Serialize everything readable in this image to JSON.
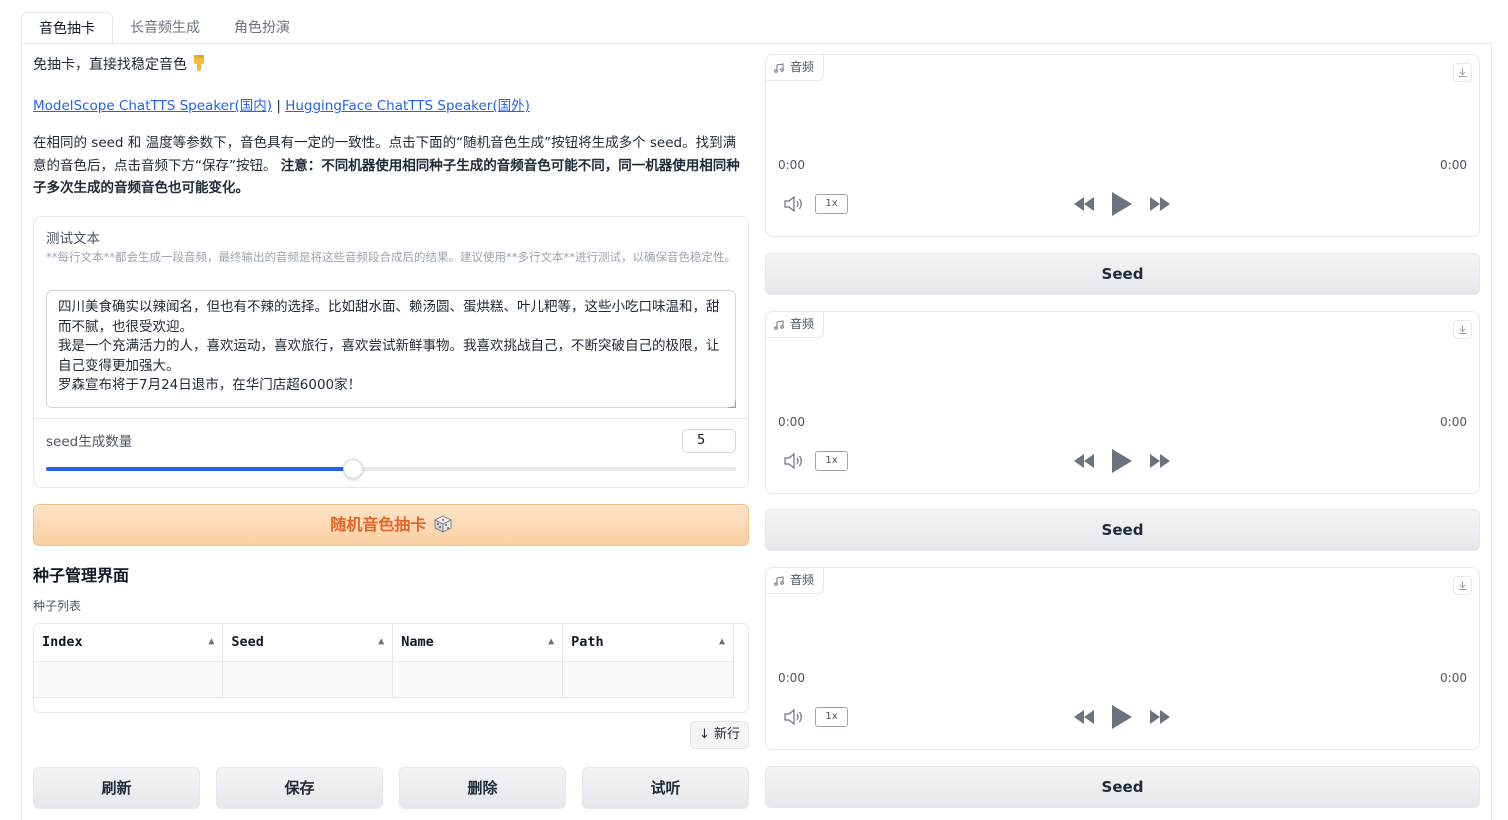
{
  "tabs": [
    {
      "label": "音色抽卡",
      "active": true
    },
    {
      "label": "长音频生成",
      "active": false
    },
    {
      "label": "角色扮演",
      "active": false
    }
  ],
  "intro": {
    "headline": "免抽卡，直接找稳定音色",
    "link1": "ModelScope ChatTTS Speaker(国内)",
    "link_sep": " | ",
    "link2": "HuggingFace ChatTTS Speaker(国外)",
    "paragraph_normal": "在相同的 seed 和 温度等参数下，音色具有一定的一致性。点击下面的“随机音色生成”按钮将生成多个 seed。找到满意的音色后，点击音频下方“保存”按钮。",
    "paragraph_bold": "注意：不同机器使用相同种子生成的音频音色可能不同，同一机器使用相同种子多次生成的音频音色也可能变化。"
  },
  "test_text": {
    "label": "测试文本",
    "info": "**每行文本**都会生成一段音频，最终输出的音频是将这些音频段合成后的结果。建议使用**多行文本**进行测试，以确保音色稳定性。",
    "value": "四川美食确实以辣闻名，但也有不辣的选择。比如甜水面、赖汤圆、蛋烘糕、叶儿粑等，这些小吃口味温和，甜而不腻，也很受欢迎。\n我是一个充满活力的人，喜欢运动，喜欢旅行，喜欢尝试新鲜事物。我喜欢挑战自己，不断突破自己的极限，让自己变得更加强大。\n罗森宣布将于7月24日退市，在华门店超6000家！"
  },
  "seed_count": {
    "label": "seed生成数量",
    "value": "5",
    "fraction": 0.445
  },
  "random_button": "随机音色抽卡",
  "seed_manager": {
    "title": "种子管理界面",
    "list_label": "种子列表",
    "columns": [
      "Index",
      "Seed",
      "Name",
      "Path"
    ],
    "new_row": "↓ 新行",
    "actions": [
      "刷新",
      "保存",
      "删除",
      "试听"
    ]
  },
  "audio_players": [
    {
      "label": "音频",
      "time_current": "0:00",
      "time_total": "0:00",
      "speed": "1x",
      "button": "Seed"
    },
    {
      "label": "音频",
      "time_current": "0:00",
      "time_total": "0:00",
      "speed": "1x",
      "button": "Seed"
    },
    {
      "label": "音频",
      "time_current": "0:00",
      "time_total": "0:00",
      "speed": "1x",
      "button": "Seed"
    }
  ],
  "colors": {
    "accent": "#2563eb",
    "primary_button_text": "#e0662a",
    "primary_button_bg": "#fbcfa0"
  }
}
